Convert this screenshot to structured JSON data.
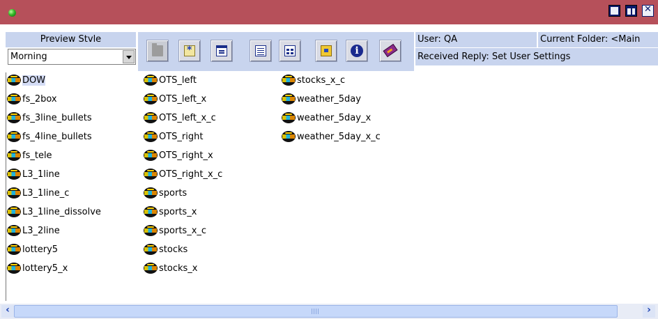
{
  "toolbar": {
    "buttons": [
      {
        "name": "open-folder",
        "icon": "folder-icon",
        "enabled": false
      },
      {
        "name": "new-item",
        "icon": "asterisk-icon",
        "enabled": true
      },
      {
        "name": "properties",
        "icon": "dialog-icon",
        "enabled": true
      },
      {
        "name": "details-view",
        "icon": "details-view-icon",
        "enabled": true
      },
      {
        "name": "list-view",
        "icon": "list-view-icon",
        "enabled": true
      },
      {
        "name": "folder-tools",
        "icon": "folder-tool-icon",
        "enabled": true
      },
      {
        "name": "info",
        "icon": "info-icon",
        "enabled": true
      },
      {
        "name": "help",
        "icon": "book-icon",
        "enabled": true
      }
    ]
  },
  "preview": {
    "label": "Preview Stvle",
    "selected": "Morning"
  },
  "status": {
    "user": "User: QA",
    "folder": "Current Folder: <Main",
    "reply": "Received Reply: Set User Settings"
  },
  "files": {
    "col1": [
      "DOW",
      "fs_2box",
      "fs_3line_bullets",
      "fs_4line_bullets",
      "fs_tele",
      "L3_1line",
      "L3_1line_c",
      "L3_1line_dissolve",
      "L3_2line",
      "lottery5",
      "lottery5_x"
    ],
    "col2": [
      "OTS_left",
      "OTS_left_x",
      "OTS_left_x_c",
      "OTS_right",
      "OTS_right_x",
      "OTS_right_x_c",
      "sports",
      "sports_x",
      "sports_x_c",
      "stocks",
      "stocks_x"
    ],
    "col3": [
      "stocks_x_c",
      "weather_5day",
      "weather_5day_x",
      "weather_5day_x_c"
    ],
    "selected": "DOW"
  },
  "colors": {
    "titlebar": "#b6505a",
    "panel": "#c8d4ee",
    "selection": "#d4dcf5"
  }
}
